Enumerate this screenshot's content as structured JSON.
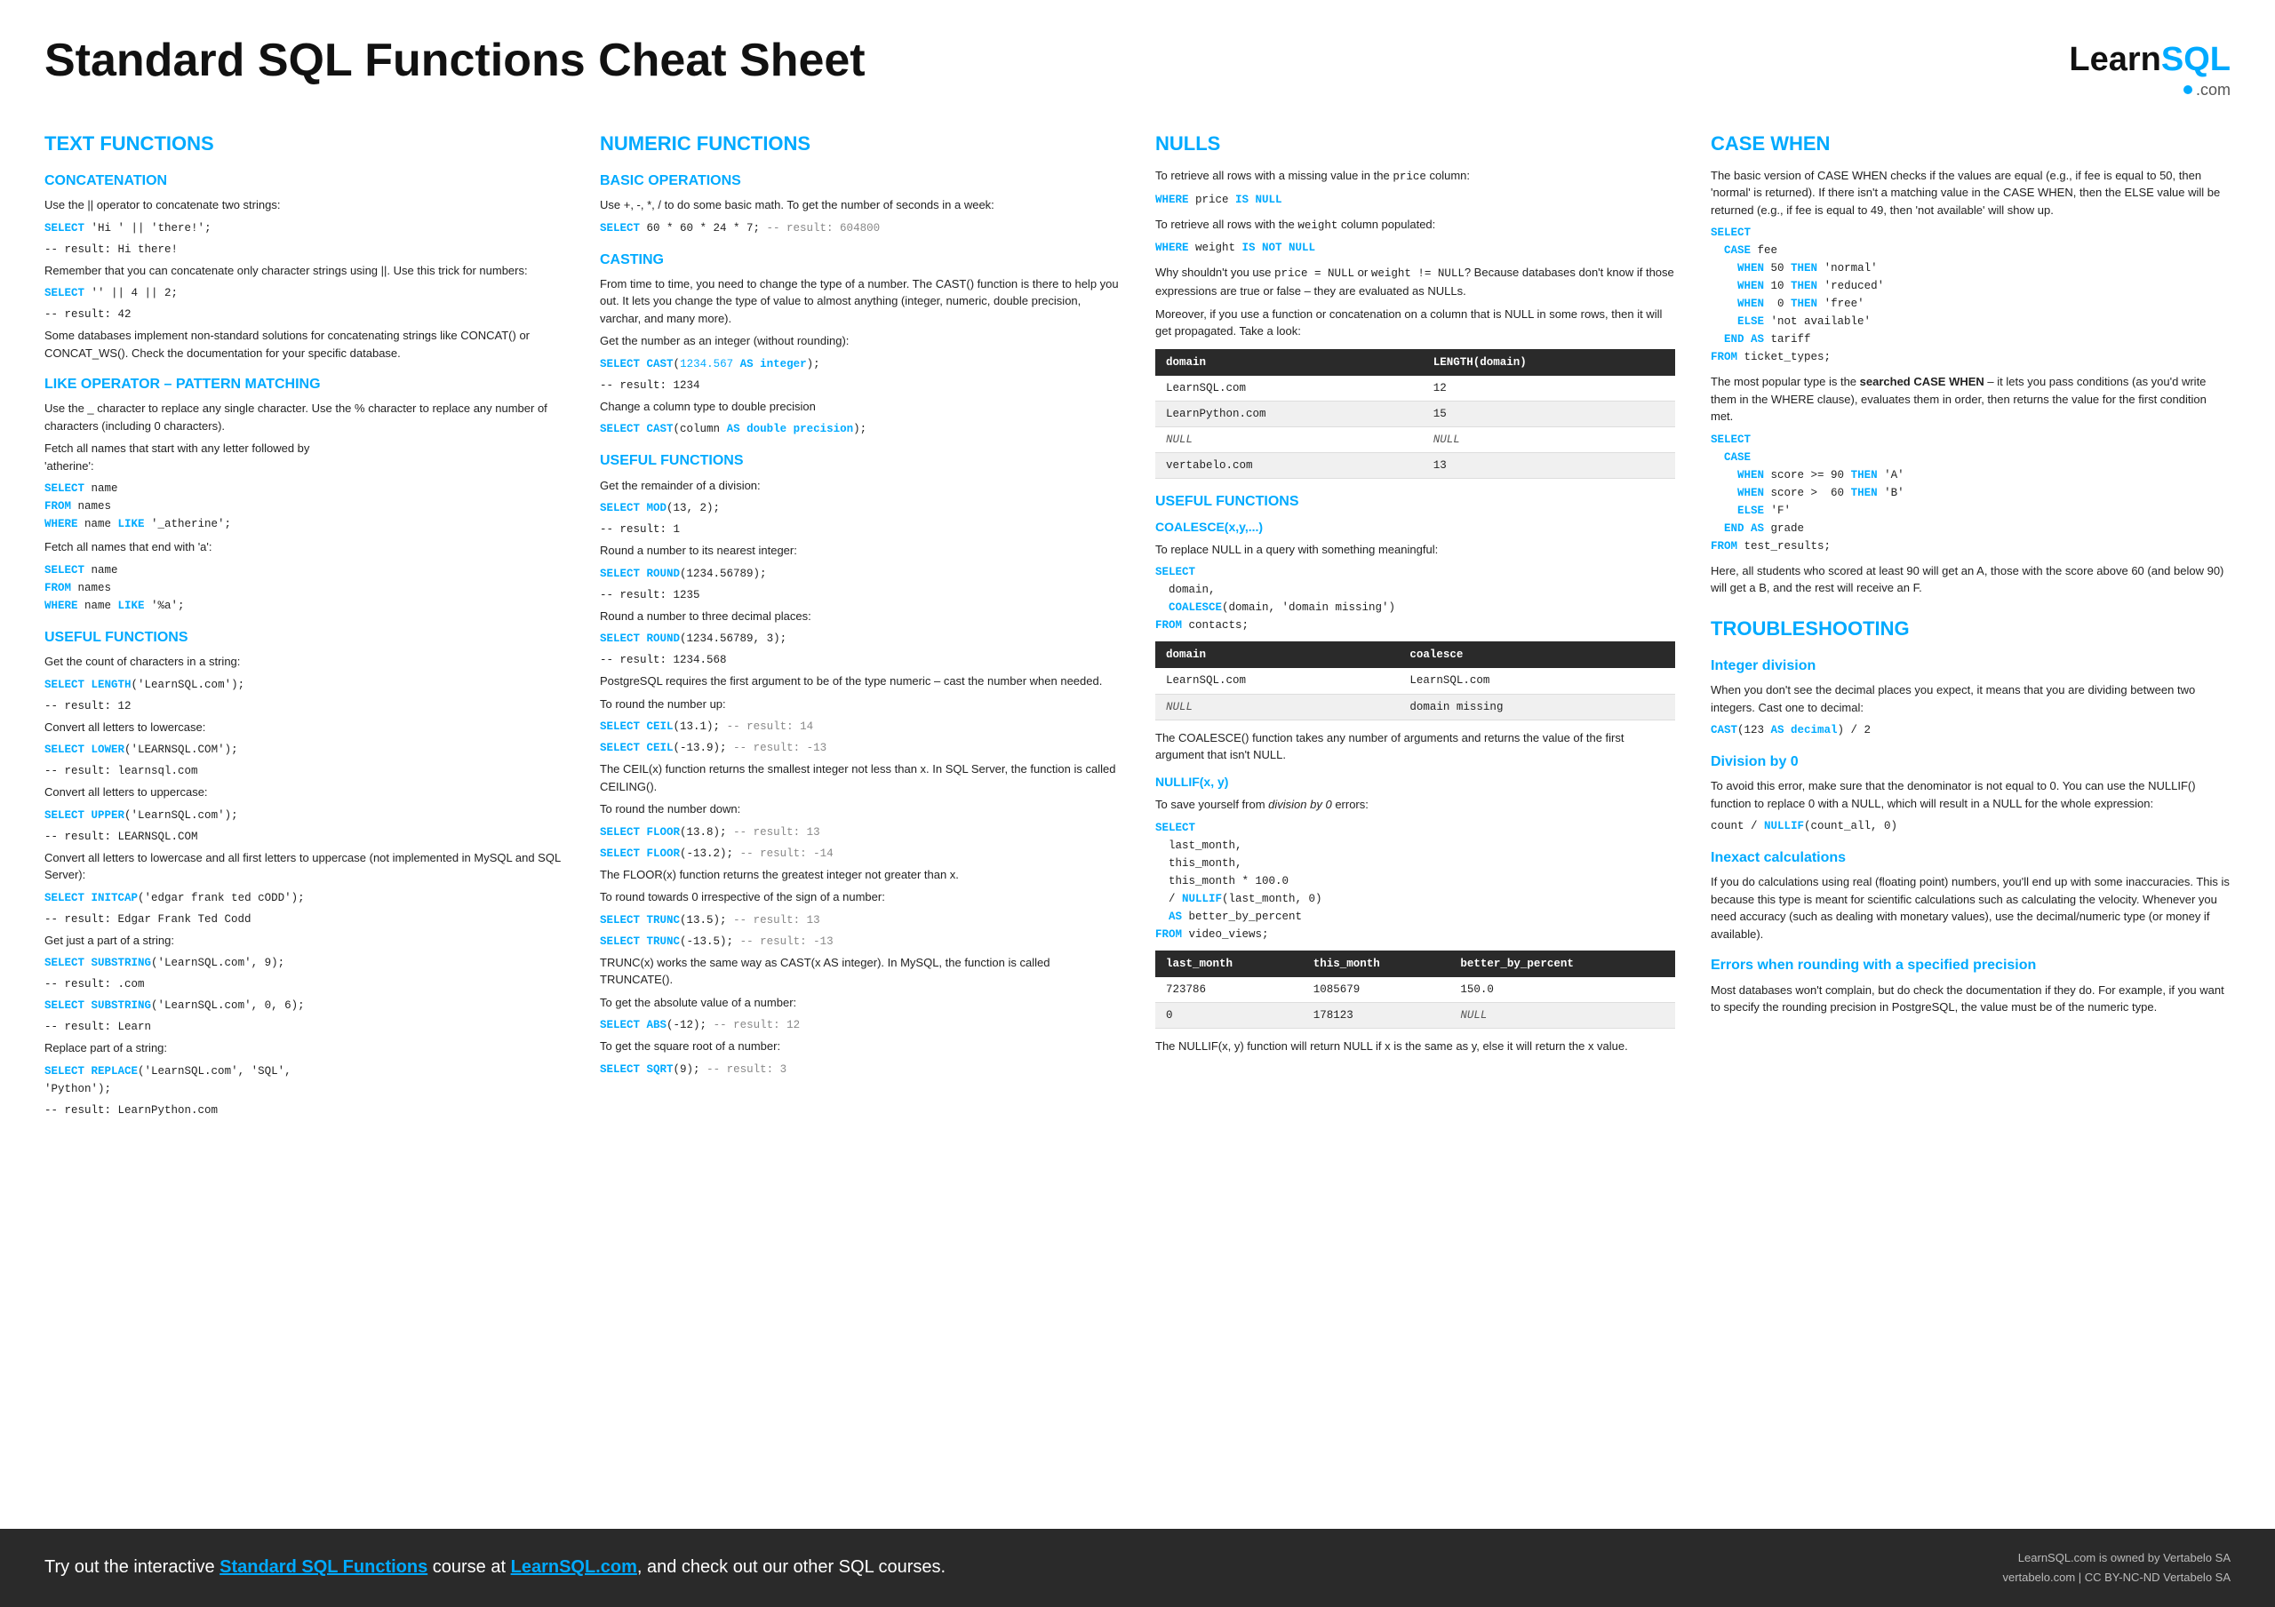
{
  "page": {
    "title": "Standard SQL Functions Cheat Sheet",
    "logo_learn": "Learn",
    "logo_sql": "SQL",
    "logo_com": ".com"
  },
  "footer": {
    "text_before": "Try out the interactive ",
    "link1": "Standard SQL Functions",
    "text_mid": " course at ",
    "link2": "LearnSQL.com",
    "text_after": ", and check out our other SQL courses.",
    "rights1": "LearnSQL.com is owned by Vertabelo SA",
    "rights2": "vertabelo.com | CC BY-NC-ND Vertabelo SA"
  },
  "col1": {
    "section": "TEXT FUNCTIONS",
    "sub1": "CONCATENATION",
    "concat_intro": "Use the || operator to concatenate two strings:",
    "concat_code1": "SELECT 'Hi ' || 'there!';",
    "concat_result1": "-- result: Hi there!",
    "concat_note": "Remember that you can concatenate only character strings using ||. Use this trick for numbers:",
    "concat_code2": "SELECT '' || 4 || 2;",
    "concat_result2": "-- result: 42",
    "concat_extra": "Some databases implement non-standard solutions for concatenating strings like CONCAT() or CONCAT_WS(). Check the documentation for your specific database.",
    "sub2": "LIKE OPERATOR – PATTERN MATCHING",
    "like_intro": "Use the _ character to replace any single character. Use the % character to replace any number of characters (including 0 characters).",
    "like_note1": "Fetch all names that start with any letter followed by 'atherine':",
    "like_code1a": "'atherine':",
    "like_code1b": "SELECT name",
    "like_code1c": "FROM names",
    "like_code1d": "WHERE name LIKE '_atherine';",
    "like_note2": "Fetch all names that end with 'a':",
    "like_code2a": "SELECT name",
    "like_code2b": "FROM names",
    "like_code2c": "WHERE name LIKE '%a';",
    "sub3": "USEFUL FUNCTIONS",
    "uf_intro1": "Get the count of characters in a string:",
    "uf_code1a": "SELECT LENGTH('LearnSQL.com');",
    "uf_code1b": "-- result: 12",
    "uf_intro2": "Convert all letters to lowercase:",
    "uf_code2a": "SELECT LOWER('LEARNSQL.COM');",
    "uf_code2b": "-- result: learnsql.com",
    "uf_intro3": "Convert all letters to uppercase:",
    "uf_code3a": "SELECT UPPER('LearnSQL.com');",
    "uf_code3b": "-- result: LEARNSQL.COM",
    "uf_intro4": "Convert all letters to lowercase and all first letters to uppercase (not implemented in MySQL and SQL Server):",
    "uf_code4a": "SELECT INITCAP('edgar frank ted cODD');",
    "uf_code4b": "-- result: Edgar Frank Ted Codd",
    "uf_intro5": "Get just a part of a string:",
    "uf_code5a": "SELECT SUBSTRING('LearnSQL.com', 9);",
    "uf_code5b": "-- result: .com",
    "uf_code5c": "SELECT SUBSTRING('LearnSQL.com', 0, 6);",
    "uf_code5d": "-- result: Learn",
    "uf_intro6": "Replace part of a string:",
    "uf_code6a": "SELECT REPLACE('LearnSQL.com', 'SQL',",
    "uf_code6b": "'Python');",
    "uf_code6c": "-- result: LearnPython.com"
  },
  "col2": {
    "section": "NUMERIC FUNCTIONS",
    "sub1": "BASIC OPERATIONS",
    "basic_intro": "Use +, -, *, / to do some basic math. To get the number of seconds in a week:",
    "basic_code": "SELECT 60 * 60 * 24 * 7; -- result: 604800",
    "sub2": "CASTING",
    "cast_intro": "From time to time, you need to change the type of a number. The CAST() function is there to help you out. It lets you change the type of value to almost anything (integer, numeric, double precision, varchar, and many more).",
    "cast_note1": "Get the number as an integer (without rounding):",
    "cast_code1a": "SELECT CAST(1234.567 AS integer);",
    "cast_code1b": "-- result: 1234",
    "cast_note2": "Change a column type to double precision",
    "cast_code2": "SELECT CAST(column AS double precision);",
    "sub3": "USEFUL FUNCTIONS",
    "uf_note1": "Get the remainder of a division:",
    "uf_code1a": "SELECT MOD(13, 2);",
    "uf_code1b": "-- result: 1",
    "uf_note2": "Round a number to its nearest integer:",
    "uf_code2a": "SELECT ROUND(1234.56789);",
    "uf_code2b": "-- result: 1235",
    "uf_note3": "Round a number to three decimal places:",
    "uf_code3a": "SELECT ROUND(1234.56789, 3);",
    "uf_code3b": "-- result: 1234.568",
    "uf_note4": "PostgreSQL requires the first argument to be of the type numeric – cast the number when needed.",
    "uf_note5": "To round the number up:",
    "uf_code5a": "SELECT CEIL(13.1); -- result: 14",
    "uf_code5b": "SELECT CEIL(-13.9); -- result: -13",
    "uf_ceil_note": "The CEIL(x) function returns the smallest integer not less than x. In SQL Server, the function is called CEILING().",
    "uf_note6": "To round the number down:",
    "uf_code6a": "SELECT FLOOR(13.8); -- result: 13",
    "uf_code6b": "SELECT FLOOR(-13.2); -- result: -14",
    "uf_floor_note": "The FLOOR(x) function returns the greatest integer not greater than x.",
    "uf_note7": "To round towards 0 irrespective of the sign of a number:",
    "uf_code7a": "SELECT TRUNC(13.5); -- result: 13",
    "uf_code7b": "SELECT TRUNC(-13.5); -- result: -13",
    "uf_trunc_note": "TRUNC(x) works the same way as CAST(x AS integer). In MySQL, the function is called TRUNCATE().",
    "uf_note8": "To get the absolute value of a number:",
    "uf_code8": "SELECT ABS(-12); -- result: 12",
    "uf_note9": "To get the square root of a number:",
    "uf_code9": "SELECT SQRT(9); -- result: 3"
  },
  "col3": {
    "section": "NULLs",
    "null_intro1": "To retrieve all rows with a missing value in the price column:",
    "null_code1": "WHERE price IS NULL",
    "null_intro2": "To retrieve all rows with the weight column populated:",
    "null_code2": "WHERE weight IS NOT NULL",
    "null_explain": "Why shouldn't you use price = NULL or weight != NULL? Because databases don't know if those expressions are true or false – they are evaluated as NULLs.",
    "null_explain2": "Moreover, if you use a function or concatenation on a column that is NULL in some rows, then it will get propagated. Take a look:",
    "null_table": {
      "headers": [
        "domain",
        "LENGTH(domain)"
      ],
      "rows": [
        [
          "LearnSQL.com",
          "12"
        ],
        [
          "LearnPython.com",
          "15"
        ],
        [
          "NULL",
          "NULL"
        ],
        [
          "vertabelo.com",
          "13"
        ]
      ]
    },
    "sub2": "USEFUL FUNCTIONS",
    "coalesce_title": "COALESCE(x,y,...)",
    "coalesce_intro": "To replace NULL in a query with something meaningful:",
    "coalesce_code": "SELECT\n  domain,\n  COALESCE(domain, 'domain missing')\nFROM contacts;",
    "coalesce_table": {
      "headers": [
        "domain",
        "coalesce"
      ],
      "rows": [
        [
          "LearnSQL.com",
          "LearnSQL.com"
        ],
        [
          "NULL",
          "domain missing"
        ]
      ]
    },
    "coalesce_note": "The COALESCE() function takes any number of arguments and returns the value of the first argument that isn't NULL.",
    "nullif_title": "NULLIF(x, y)",
    "nullif_intro": "To save yourself from division by 0 errors:",
    "nullif_code": "SELECT\n  last_month,\n  this_month,\n  this_month * 100.0\n  / NULLIF(last_month, 0)\n  AS better_by_percent\nFROM video_views;",
    "nullif_table": {
      "headers": [
        "last_month",
        "this_month",
        "better_by_percent"
      ],
      "rows": [
        [
          "723786",
          "1085679",
          "150.0"
        ],
        [
          "0",
          "178123",
          "NULL"
        ]
      ]
    },
    "nullif_note": "The NULLIF(x, y) function will return NULL if x is the same as y, else it will return the x value."
  },
  "col4": {
    "section": "CASE WHEN",
    "cw_intro": "The basic version of CASE WHEN checks if the values are equal (e.g., if fee is equal to 50, then 'normal' is returned). If there isn't a matching value in the CASE WHEN, then the ELSE value will be returned (e.g., if fee is equal to 49, then 'not available' will show up.",
    "cw_code1": "SELECT\n  CASE fee\n    WHEN 50 THEN 'normal'\n    WHEN 10 THEN 'reduced'\n    WHEN  0 THEN 'free'\n    ELSE 'not available'\n  END AS tariff\nFROM ticket_types;",
    "cw_note2": "The most popular type is the searched CASE WHEN – it lets you pass conditions (as you'd write them in the WHERE clause), evaluates them in order, then returns the value for the first condition met.",
    "cw_code2": "SELECT\n  CASE\n    WHEN score >= 90 THEN 'A'\n    WHEN score >  60 THEN 'B'\n    ELSE 'F'\n  END AS grade\nFROM test_results;",
    "cw_note3": "Here, all students who scored at least 90 will get an A, those with the score above 60 (and below 90) will get a B, and the rest will receive an F.",
    "sub2": "TROUBLESHOOTING",
    "ts_sub1": "Integer division",
    "ts_int_note": "When you don't see the decimal places you expect, it means that you are dividing between two integers. Cast one to decimal:",
    "ts_int_code": "CAST(123 AS decimal) / 2",
    "ts_sub2": "Division by 0",
    "ts_div0_note": "To avoid this error, make sure that the denominator is not equal to 0. You can use the NULLIF() function to replace 0 with a NULL, which will result in a NULL for the whole expression:",
    "ts_div0_code": "count / NULLIF(count_all, 0)",
    "ts_sub3": "Inexact calculations",
    "ts_inexact_note": "If you do calculations using real (floating point) numbers, you'll end up with some inaccuracies. This is because this type is meant for scientific calculations such as calculating the velocity. Whenever you need accuracy (such as dealing with monetary values), use the decimal/numeric type (or money if available).",
    "ts_sub4": "Errors when rounding with a specified precision",
    "ts_round_note": "Most databases won't complain, but do check the documentation if they do. For example, if you want to specify the rounding precision in PostgreSQL, the value must be of the numeric type."
  }
}
